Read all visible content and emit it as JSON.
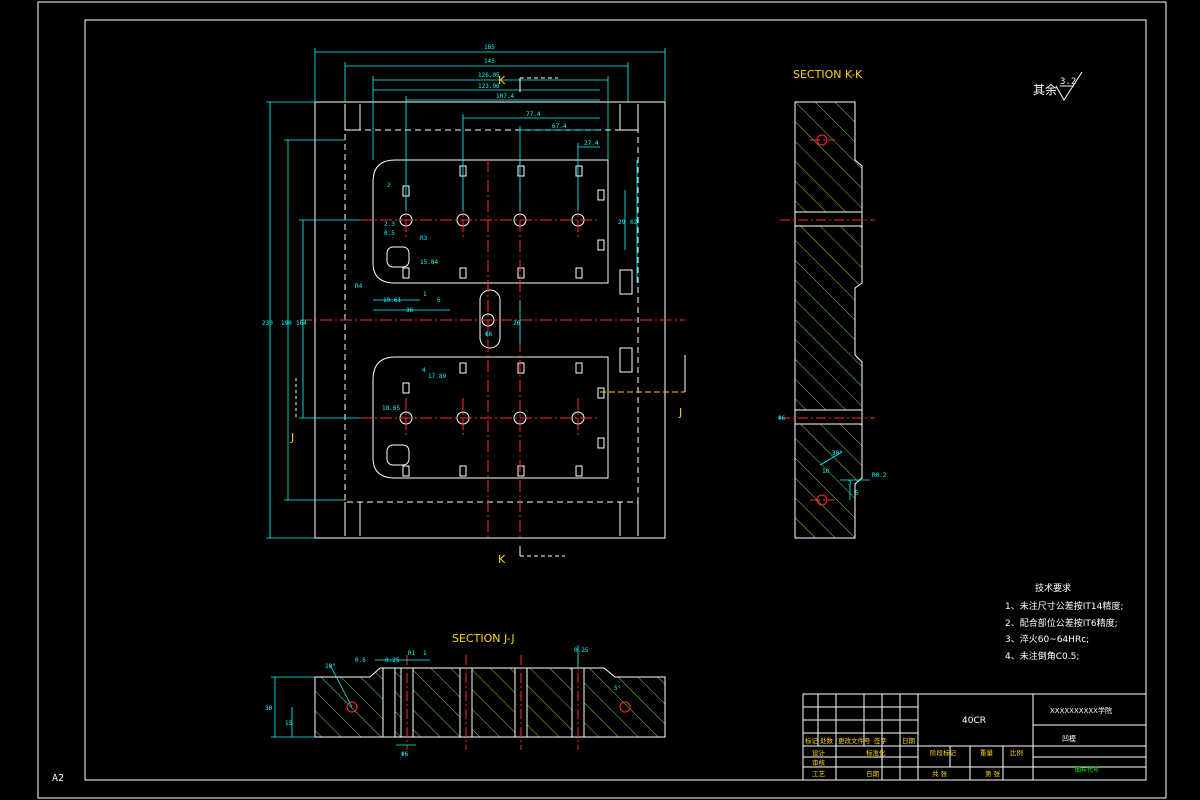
{
  "colors": {
    "background": "#000000",
    "frame": "#ffffff",
    "outline": "#ffffff",
    "dimension": "#00ffff",
    "centerline": "#ff2a2a",
    "hatch": "#7cd34a",
    "label": "#ffd400",
    "table_text": "#ffd400",
    "green_text": "#00ff00"
  },
  "sheet": {
    "size_label": "A2"
  },
  "roughness": {
    "prefix": "其余",
    "value": "3.2"
  },
  "main_view": {
    "section_marks": {
      "k_top": "K",
      "k_bottom": "K",
      "j_left": "J",
      "j_right": "J"
    },
    "dims": {
      "w185": "185",
      "w145": "145",
      "w126": "126.05",
      "w123": "123.96",
      "w107": "107.4",
      "w77": "77.4",
      "w67": "67.4",
      "w27": "27.4",
      "d2": "2",
      "d23": "2.3",
      "d05": "0.5",
      "r3": "R3",
      "r4": "R4",
      "d1584": "15.84",
      "d1961": "19.61",
      "d36": "36",
      "d6": "6",
      "d1": "1",
      "d29": "29",
      "d62": "62",
      "h230": "230",
      "h190": "190",
      "h164": "164",
      "phi6": "Φ6",
      "d26": "26",
      "d1789": "17.89",
      "d1865": "18.65",
      "d4": "4"
    }
  },
  "section_kk": {
    "title": "SECTION K-K",
    "dims": {
      "phi6": "Φ6",
      "a30": "30°",
      "r02": "R0.2",
      "d5": "5",
      "d3": "3",
      "d10": "10"
    }
  },
  "section_jj": {
    "title": "SECTION J-J",
    "dims": {
      "d06": "0.6",
      "d025a": "0.25",
      "d025b": "0.25",
      "r1": "R1",
      "d1": "1",
      "h30": "30",
      "h15": "15",
      "a10": "10°",
      "a5": "5°",
      "phi6": "Φ6"
    }
  },
  "tech_requirements": {
    "title": "技术要求",
    "items": [
      "1、未注尺寸公差按IT14精度;",
      "2、配合部位公差按IT6精度;",
      "3、淬火60~64HRc;",
      "4、未注倒角C0.5;"
    ]
  },
  "title_block": {
    "material": "40CR",
    "school": "XXXXXXXXXX学院",
    "part_name": "凹模",
    "drawing_no": "图样代号",
    "hdr_mark": "标记",
    "hdr_count": "处数",
    "hdr_zone": "更改文件号",
    "hdr_sign": "签字",
    "hdr_date": "日期",
    "designer": "设计",
    "standard": "标准化",
    "checker": "审核",
    "process": "工艺",
    "date": "日期",
    "stage_mark": "阶段标记",
    "weight": "重量",
    "scale": "比例",
    "sheets_total": "共 张",
    "sheet_no": "第 张"
  }
}
